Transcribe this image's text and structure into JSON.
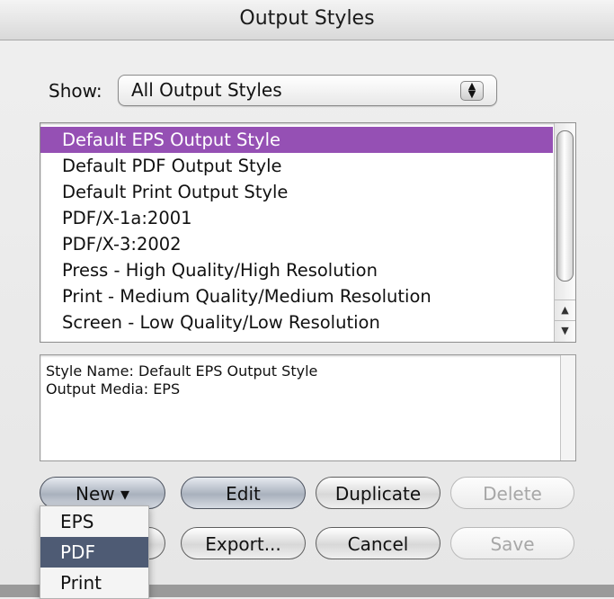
{
  "window": {
    "title": "Output Styles"
  },
  "show": {
    "label": "Show:",
    "value": "All Output Styles"
  },
  "styles_list": {
    "items": [
      "Default EPS Output Style",
      "Default PDF Output Style",
      "Default Print Output Style",
      "PDF/X-1a:2001",
      "PDF/X-3:2002",
      "Press - High Quality/High Resolution",
      "Print - Medium Quality/Medium Resolution",
      "Screen - Low Quality/Low Resolution"
    ],
    "selected_index": 0
  },
  "description": {
    "lines": [
      "Style Name: Default EPS Output Style",
      "Output Media: EPS"
    ]
  },
  "buttons": {
    "new": "New ▾",
    "edit": "Edit",
    "duplicate": "Duplicate",
    "delete": "Delete",
    "export": "Export...",
    "cancel": "Cancel",
    "save": "Save"
  },
  "new_menu": {
    "items": [
      "EPS",
      "PDF",
      "Print"
    ],
    "highlighted_index": 1
  },
  "colors": {
    "selection": "#9550b4",
    "menu_highlight": "#4e5b74"
  }
}
